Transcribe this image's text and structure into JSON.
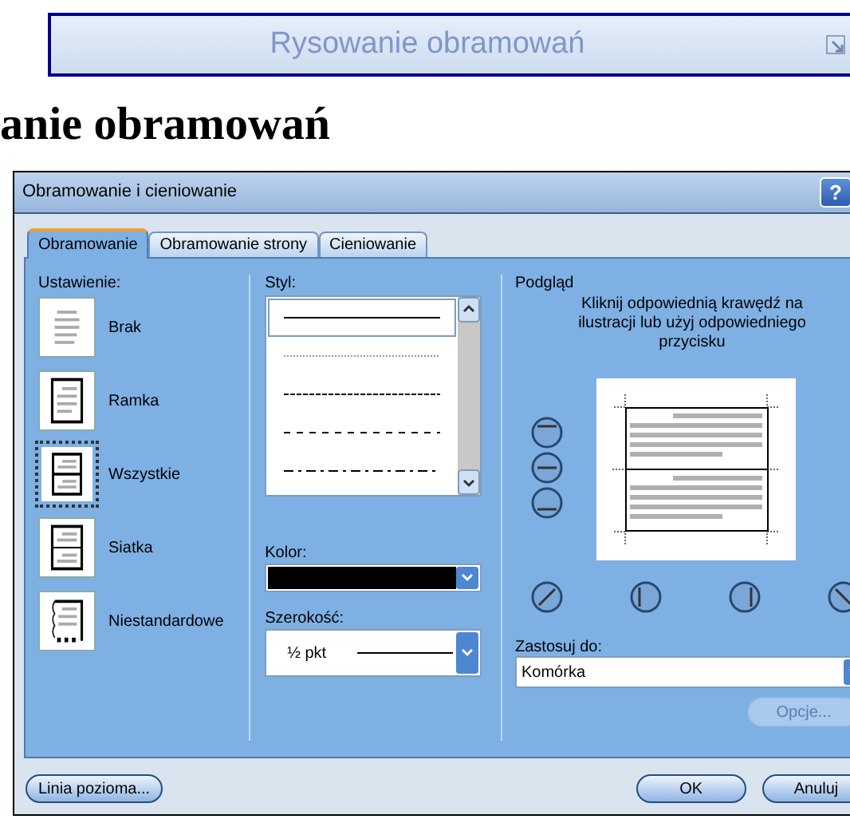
{
  "ribbon_group": {
    "label": "Rysowanie obramowań"
  },
  "heading": "anie obramowań",
  "dialog": {
    "title": "Obramowanie i cieniowanie",
    "help": "?",
    "tabs": [
      {
        "label": "Obramowanie",
        "selected": true
      },
      {
        "label": "Obramowanie strony",
        "selected": false
      },
      {
        "label": "Cieniowanie",
        "selected": false
      }
    ],
    "settings": {
      "label": "Ustawienie:",
      "items": [
        {
          "kind": "none",
          "label": "Brak",
          "selected": false
        },
        {
          "kind": "box",
          "label": "Ramka",
          "selected": false
        },
        {
          "kind": "all",
          "label": "Wszystkie",
          "selected": true
        },
        {
          "kind": "grid",
          "label": "Siatka",
          "selected": false
        },
        {
          "kind": "custom",
          "label": "Niestandardowe",
          "selected": false
        }
      ]
    },
    "style": {
      "label": "Styl:",
      "items": [
        {
          "kind": "solid",
          "selected": true
        },
        {
          "kind": "dotted",
          "selected": false
        },
        {
          "kind": "fine-dash",
          "selected": false
        },
        {
          "kind": "dash",
          "selected": false
        },
        {
          "kind": "dash-dot",
          "selected": false
        }
      ]
    },
    "color": {
      "label": "Kolor:",
      "color": "#000000"
    },
    "width": {
      "label": "Szerokość:",
      "value": "½ pkt"
    },
    "preview": {
      "label": "Podgląd",
      "instruction": "Kliknij odpowiednią krawędź na ilustracji lub użyj odpowiedniego przycisku"
    },
    "apply_to": {
      "label": "Zastosuj do:",
      "value": "Komórka"
    },
    "options_button": {
      "label": "Opcje...",
      "disabled": true
    },
    "footer_buttons": [
      "Linia pozioma...",
      "OK",
      "Anuluj"
    ]
  }
}
